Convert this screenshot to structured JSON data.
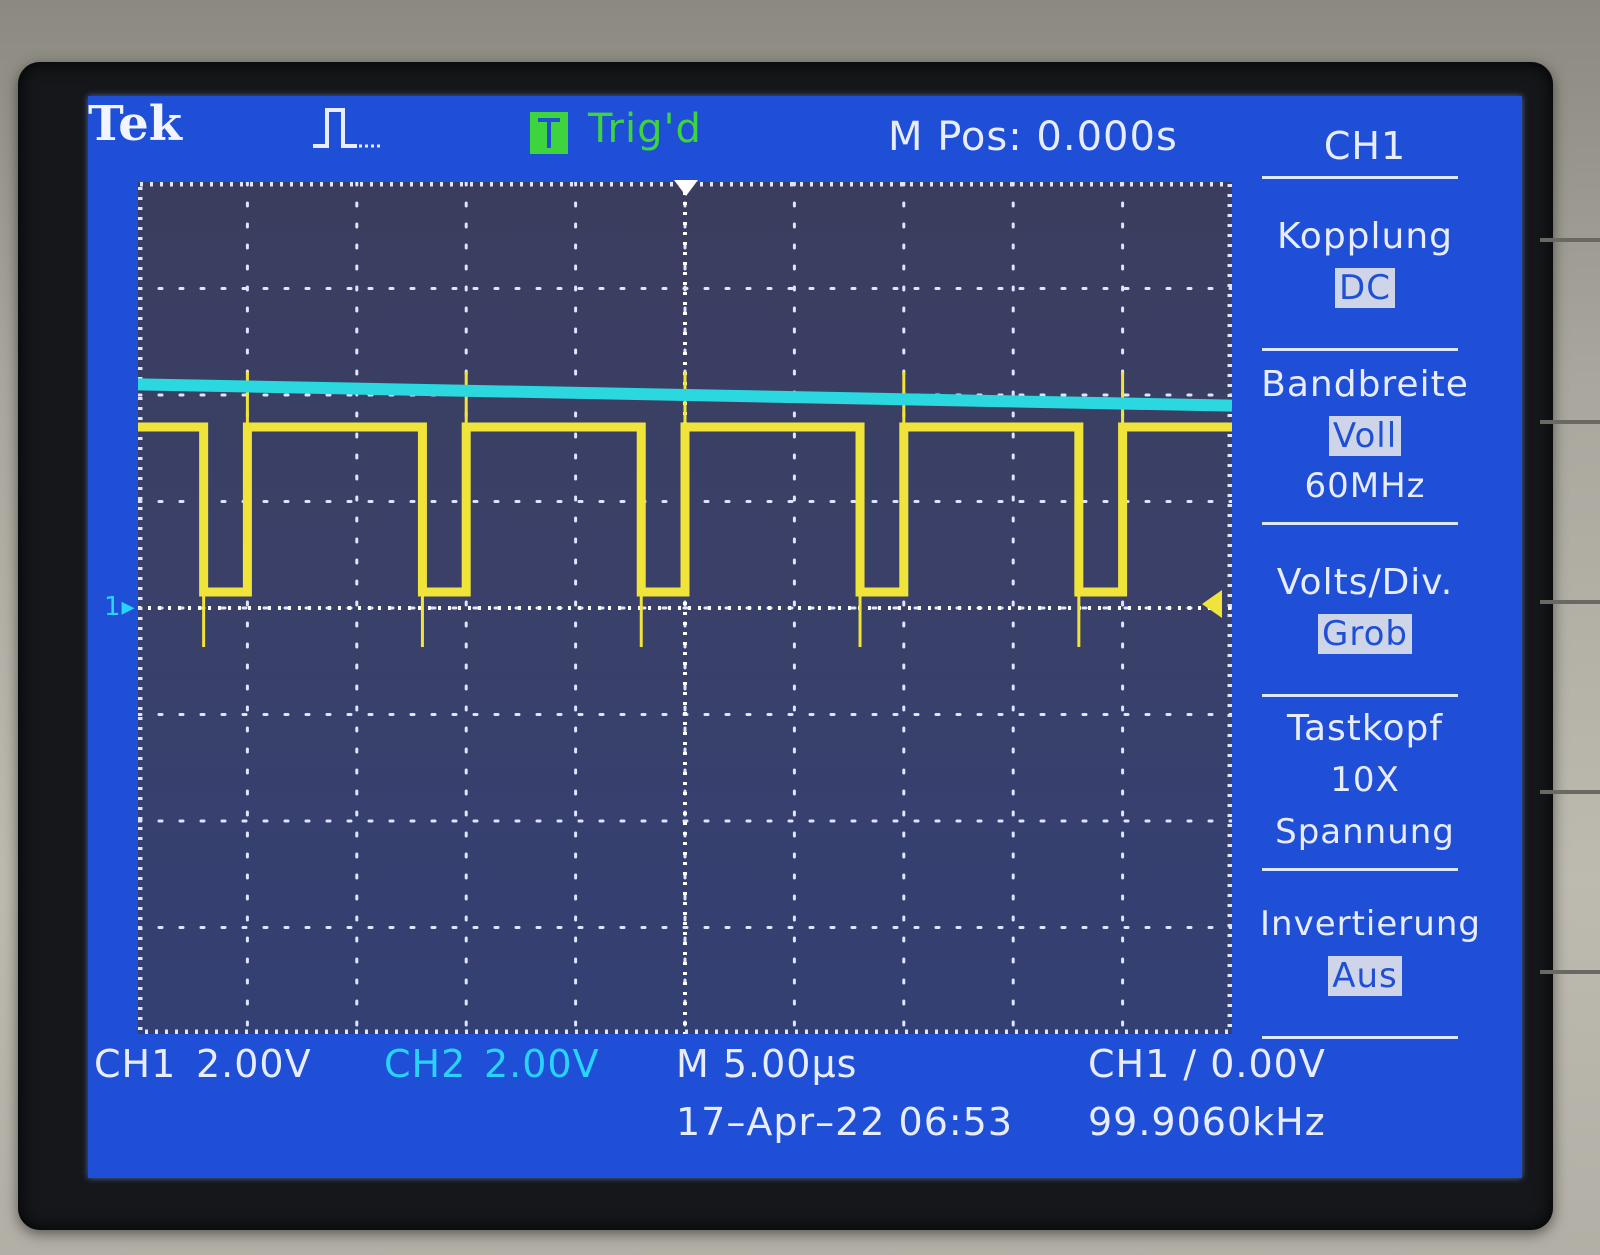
{
  "header": {
    "brand": "Tek",
    "trigger_status": "Trig'd",
    "m_pos": "M Pos: 0.000s",
    "menu_channel": "CH1"
  },
  "side_menu": [
    {
      "title": "Kopplung",
      "value": "DC",
      "boxed": true
    },
    {
      "title": "Bandbreite",
      "value": "Voll",
      "value2": "60MHz",
      "boxed": true
    },
    {
      "title": "Volts/Div.",
      "value": "Grob",
      "boxed": true
    },
    {
      "title": "Tastkopf",
      "value": "10X",
      "value2": "Spannung",
      "boxed": false
    },
    {
      "title": "Invertierung",
      "value": "Aus",
      "boxed": true
    }
  ],
  "footer": {
    "ch1_label": "CH1",
    "ch1_scale": "2.00V",
    "ch2_label": "CH2",
    "ch2_scale": "2.00V",
    "timebase": "M 5.00µs",
    "trigger_setting": "CH1 ∕ 0.00V",
    "datetime": "17–Apr–22 06:53",
    "frequency": "99.9060kHz"
  },
  "ch1_marker": "1",
  "colors": {
    "screen_bg": "#1f4fd6",
    "ch1": "#f0e43a",
    "ch2": "#2bd8e0",
    "trig_green": "#3ed43e"
  },
  "chart_data": {
    "type": "line",
    "xlabel": "",
    "ylabel": "",
    "x_unit": "divisions (5.00µs/div)",
    "y_unit": "divisions (2.00V/div)",
    "xlim": [
      -5,
      5
    ],
    "ylim": [
      -4,
      4
    ],
    "grid": true,
    "series": [
      {
        "name": "CH1",
        "color": "#f0e43a",
        "x": [
          -5.0,
          -4.4,
          -4.4,
          -4.0,
          -4.0,
          -2.4,
          -2.4,
          -2.0,
          -2.0,
          -0.4,
          -0.4,
          0.0,
          0.0,
          1.6,
          1.6,
          2.0,
          2.0,
          3.6,
          3.6,
          4.0,
          4.0,
          5.0
        ],
        "y": [
          1.7,
          1.7,
          0.15,
          0.15,
          1.7,
          1.7,
          0.15,
          0.15,
          1.7,
          1.7,
          0.15,
          0.15,
          1.7,
          1.7,
          0.15,
          0.15,
          1.7,
          1.7,
          0.15,
          0.15,
          1.7,
          1.7
        ]
      },
      {
        "name": "CH2",
        "color": "#2bd8e0",
        "x": [
          -5.0,
          5.0
        ],
        "y": [
          2.1,
          1.9
        ]
      }
    ]
  }
}
